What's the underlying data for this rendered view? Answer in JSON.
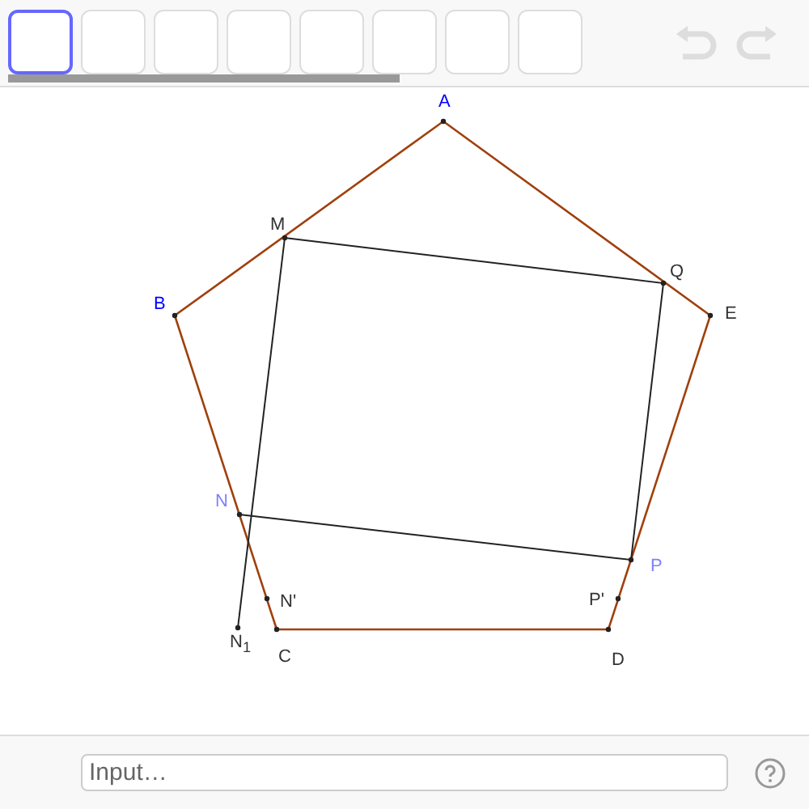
{
  "toolbar": {
    "tools": [
      {
        "selected": true
      },
      {
        "selected": false
      },
      {
        "selected": false
      },
      {
        "selected": false
      },
      {
        "selected": false
      },
      {
        "selected": false
      },
      {
        "selected": false
      },
      {
        "selected": false
      }
    ]
  },
  "points": [
    {
      "label": "A",
      "color": "#0000ff"
    },
    {
      "label": "B",
      "color": "#0000ff"
    },
    {
      "label": "C",
      "color": "#333333"
    },
    {
      "label": "D",
      "color": "#333333"
    },
    {
      "label": "E",
      "color": "#333333"
    },
    {
      "label": "M",
      "color": "#333333"
    },
    {
      "label": "Q",
      "color": "#333333"
    },
    {
      "label": "N",
      "color": "#7f7fff"
    },
    {
      "label": "P",
      "color": "#7f7fff"
    },
    {
      "label": "N'",
      "color": "#333333"
    },
    {
      "label": "P'",
      "color": "#333333"
    },
    {
      "label": "N$_{1}$",
      "color": "#333333"
    }
  ],
  "input_bar": {
    "placeholder": "Input…"
  }
}
